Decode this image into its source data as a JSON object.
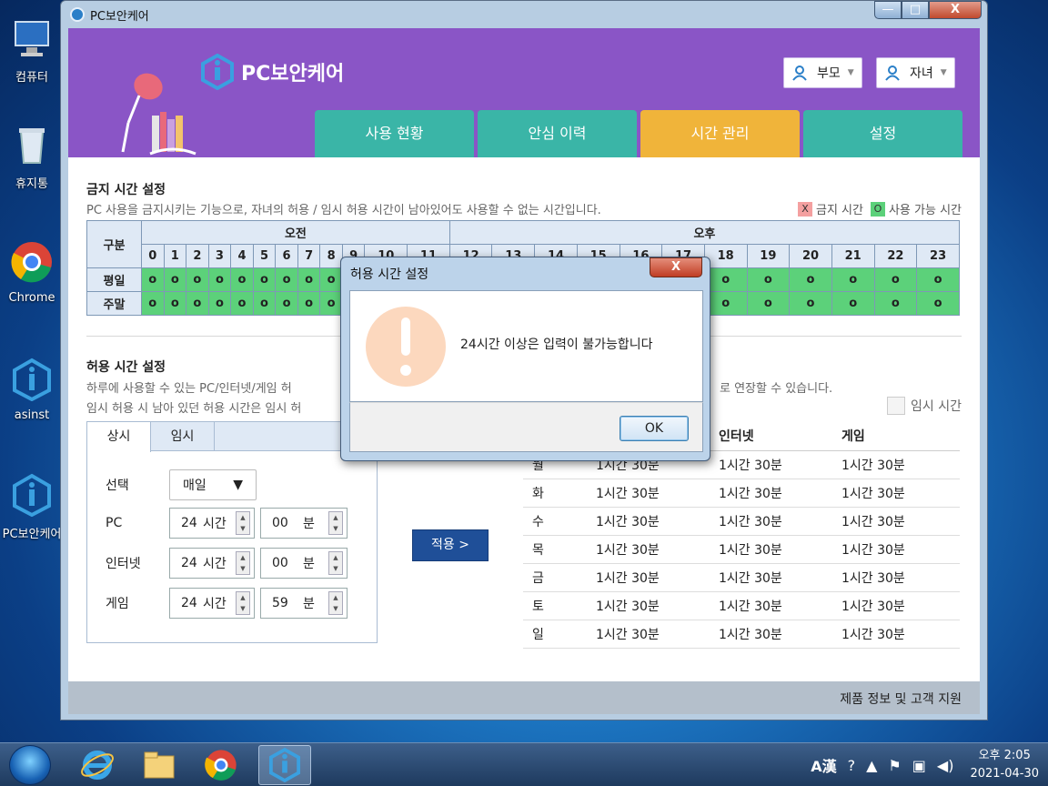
{
  "desktop": {
    "icons": [
      {
        "label": "컴퓨터"
      },
      {
        "label": "휴지통"
      },
      {
        "label": "Chrome"
      },
      {
        "label": "asinst"
      },
      {
        "label": "PC보안케어"
      }
    ]
  },
  "window": {
    "title": "PC보안케어",
    "minimize": "—",
    "maximize": "□",
    "close": "X"
  },
  "app": {
    "logo_text": "PC보안케어",
    "users": {
      "parent": "부모",
      "child": "자녀"
    },
    "tabs": [
      "사용 현황",
      "안심 이력",
      "시간 관리",
      "설정"
    ],
    "active_tab": "시간 관리"
  },
  "forbidden": {
    "title": "금지 시간 설정",
    "desc": "PC 사용을 금지시키는 기능으로, 자녀의 허용 / 임시 허용 시간이 남아있어도 사용할 수 없는 시간입니다.",
    "legend": {
      "forbidden_mark": "X",
      "forbidden_label": "금지 시간",
      "allowed_mark": "O",
      "allowed_label": "사용 가능 시간"
    },
    "corner": "구분",
    "am": "오전",
    "pm": "오후",
    "hours": [
      "0",
      "1",
      "2",
      "3",
      "4",
      "5",
      "6",
      "7",
      "8",
      "9",
      "10",
      "11",
      "12",
      "13",
      "14",
      "15",
      "16",
      "17",
      "18",
      "19",
      "20",
      "21",
      "22",
      "23"
    ],
    "rows": [
      {
        "label": "평일",
        "cells": [
          "o",
          "o",
          "o",
          "o",
          "o",
          "o",
          "o",
          "o",
          "o",
          "o",
          "o",
          "o",
          "o",
          "o",
          "o",
          "o",
          "o",
          "o",
          "o",
          "o",
          "o",
          "o",
          "o",
          "o"
        ]
      },
      {
        "label": "주말",
        "cells": [
          "o",
          "o",
          "o",
          "o",
          "o",
          "o",
          "o",
          "o",
          "o",
          "o",
          "o",
          "o",
          "o",
          "o",
          "o",
          "o",
          "o",
          "o",
          "o",
          "o",
          "o",
          "o",
          "o",
          "o"
        ]
      }
    ]
  },
  "allowed": {
    "title": "허용 시간 설정",
    "desc1": "하루에 사용할 수 있는 PC/인터넷/게임 허",
    "desc1_tail": "로 연장할 수 있습니다.",
    "desc2": "임시 허용 시 남아 있던 허용 시간은 임시 허",
    "temp_checkbox": "임시 시간",
    "subtabs": [
      "상시",
      "임시"
    ],
    "select_label": "선택",
    "select_value": "매일",
    "rows": [
      {
        "label": "PC",
        "hours": "24",
        "hours_unit": "시간",
        "minutes": "00",
        "minutes_unit": "분"
      },
      {
        "label": "인터넷",
        "hours": "24",
        "hours_unit": "시간",
        "minutes": "00",
        "minutes_unit": "분"
      },
      {
        "label": "게임",
        "hours": "24",
        "hours_unit": "시간",
        "minutes": "59",
        "minutes_unit": "분"
      }
    ],
    "apply": "적용 >"
  },
  "schedule": {
    "headers": [
      "",
      "",
      "인터넷",
      "게임"
    ],
    "rows": [
      [
        "월",
        "1시간 30분",
        "1시간 30분",
        "1시간 30분"
      ],
      [
        "화",
        "1시간 30분",
        "1시간 30분",
        "1시간 30분"
      ],
      [
        "수",
        "1시간 30분",
        "1시간 30분",
        "1시간 30분"
      ],
      [
        "목",
        "1시간 30분",
        "1시간 30분",
        "1시간 30분"
      ],
      [
        "금",
        "1시간 30분",
        "1시간 30분",
        "1시간 30분"
      ],
      [
        "토",
        "1시간 30분",
        "1시간 30분",
        "1시간 30분"
      ],
      [
        "일",
        "1시간 30분",
        "1시간 30분",
        "1시간 30분"
      ]
    ]
  },
  "footer": {
    "text": "제품 정보 및 고객 지원"
  },
  "dialog": {
    "title": "허용 시간 설정",
    "close": "X",
    "message": "24시간 이상은 입력이 불가능합니다",
    "ok": "OK"
  },
  "taskbar": {
    "clock_time": "오후 2:05",
    "clock_date": "2021-04-30",
    "ime": "A漢"
  }
}
